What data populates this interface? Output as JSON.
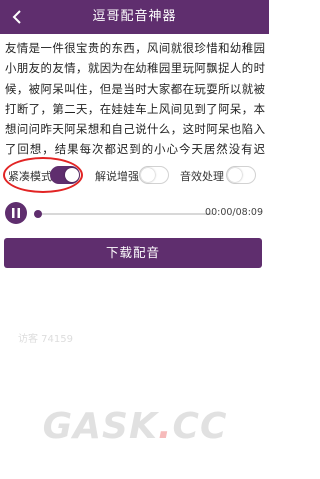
{
  "header": {
    "title": "逗哥配音神器",
    "back_icon": "chevron-left-icon"
  },
  "article": {
    "text": "友情是一件很宝贵的东西，风间就很珍惜和幼稚园小朋友的友情，就因为在幼稚园里玩阿飘捉人的时候，被阿呆叫住，但是当时大家都在玩耍所以就被打断了，第二天，在娃娃车上风间见到了阿呆，本想问问昨天阿呆想和自己说什么，这时阿呆也陷入了回想，结果每次都迟到的小心今天居然没有迟到，还一下把风间撞到一边，然后从口袋里掏出来一个自认为不普通的石头给阿呆看，阿呆很错一变，然后先问他漂亮"
  },
  "options": {
    "compact_mode": {
      "label": "紧凑模式",
      "on": true
    },
    "narration_boost": {
      "label": "解说增强",
      "on": false
    },
    "sound_effect": {
      "label": "音效处理",
      "on": false
    }
  },
  "player": {
    "state_icon": "pause-icon",
    "progress": 0.0,
    "time": "00:00/08:09"
  },
  "actions": {
    "download_label": "下载配音"
  },
  "watermarks": {
    "user_tag_1": "访客 74159",
    "user_tag_2": "访客 74159",
    "site_logo": "GASK.CC"
  },
  "colors": {
    "accent": "#5f2e6e",
    "highlight": "#e22424"
  }
}
